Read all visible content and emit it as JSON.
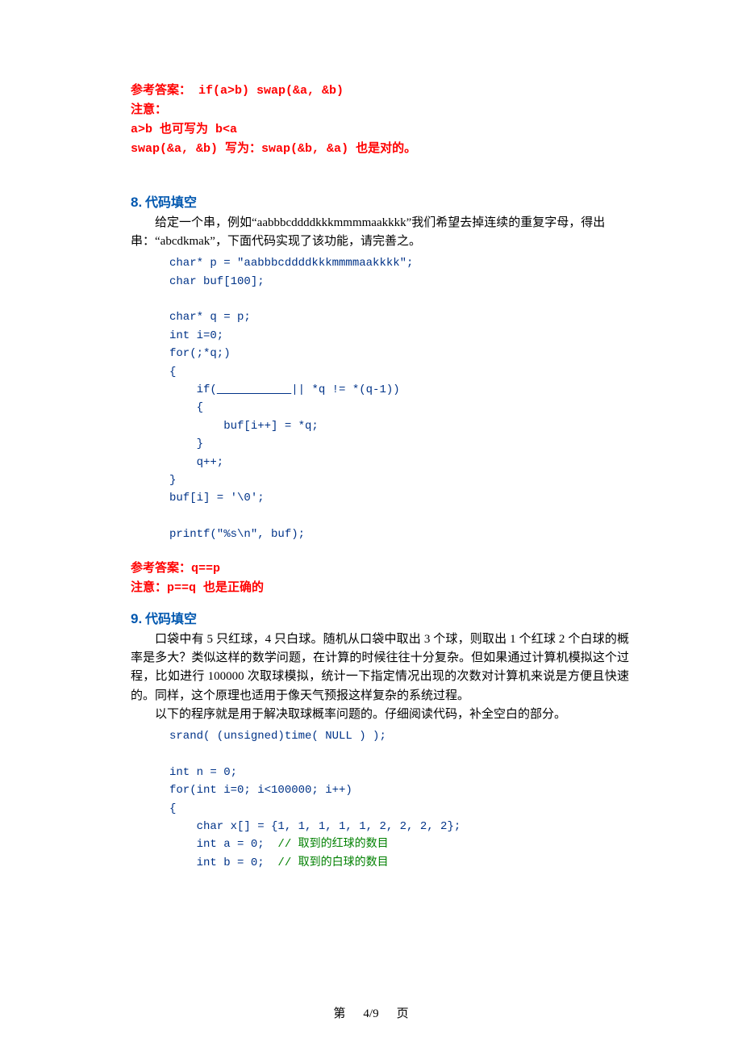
{
  "top": {
    "ans_label": "参考答案：",
    "ans_code": " if(a>b)  swap(&a, &b)",
    "note_label": "注意：",
    "note_line1_a": "a>b ",
    "note_line1_mid": "也可写为",
    "note_line1_b": " b<a",
    "note_line2_a": "swap(&a, &b) ",
    "note_line2_mid": "写为：",
    "note_line2_b": "swap(&b, &a) ",
    "note_line2_end": "也是对的。"
  },
  "q8": {
    "num": "8.",
    "title": "代码填空",
    "para1": "给定一个串，例如“aabbbcddddkkkmmmmaakkkk”我们希望去掉连续的重复字母，得出串：“abcdkmak”，下面代码实现了该功能，请完善之。",
    "code": "char* p = \"aabbbcddddkkkmmmmaakkkk\";\nchar buf[100];\n\nchar* q = p;\nint i=0;\nfor(;*q;)\n{\n    if(___________|| *q != *(q-1))\n    {\n        buf[i++] = *q;\n    }\n    q++;\n}\nbuf[i] = '\\0';\n\nprintf(\"%s\\n\", buf);",
    "ans_label": "参考答案：",
    "ans_code": "q==p",
    "note_label": "注意：",
    "note_code": "p==q ",
    "note_end": "也是正确的"
  },
  "q9": {
    "num": "9.",
    "title": "代码填空",
    "para1": "口袋中有 5 只红球，4 只白球。随机从口袋中取出 3 个球，则取出 1 个红球 2 个白球的概率是多大？类似这样的数学问题，在计算的时候往往十分复杂。但如果通过计算机模拟这个过程，比如进行 100000 次取球模拟，统计一下指定情况出现的次数对计算机来说是方便且快速的。同样，这个原理也适用于像天气预报这样复杂的系统过程。",
    "para2": "以下的程序就是用于解决取球概率问题的。仔细阅读代码，补全空白的部分。",
    "code_lines": [
      {
        "t": "srand( (unsigned)time( NULL ) );"
      },
      {
        "t": ""
      },
      {
        "t": "int n = 0;"
      },
      {
        "t": "for(int i=0; i<100000; i++)"
      },
      {
        "t": "{"
      },
      {
        "t": "    char x[] = {1, 1, 1, 1, 1, 2, 2, 2, 2};"
      },
      {
        "t": "    int a = 0;  ",
        "c": "// 取到的红球的数目"
      },
      {
        "t": "    int b = 0;  ",
        "c": "// 取到的白球的数目"
      }
    ]
  },
  "footer": {
    "left": "第",
    "mid": "4/9",
    "right": "页"
  }
}
